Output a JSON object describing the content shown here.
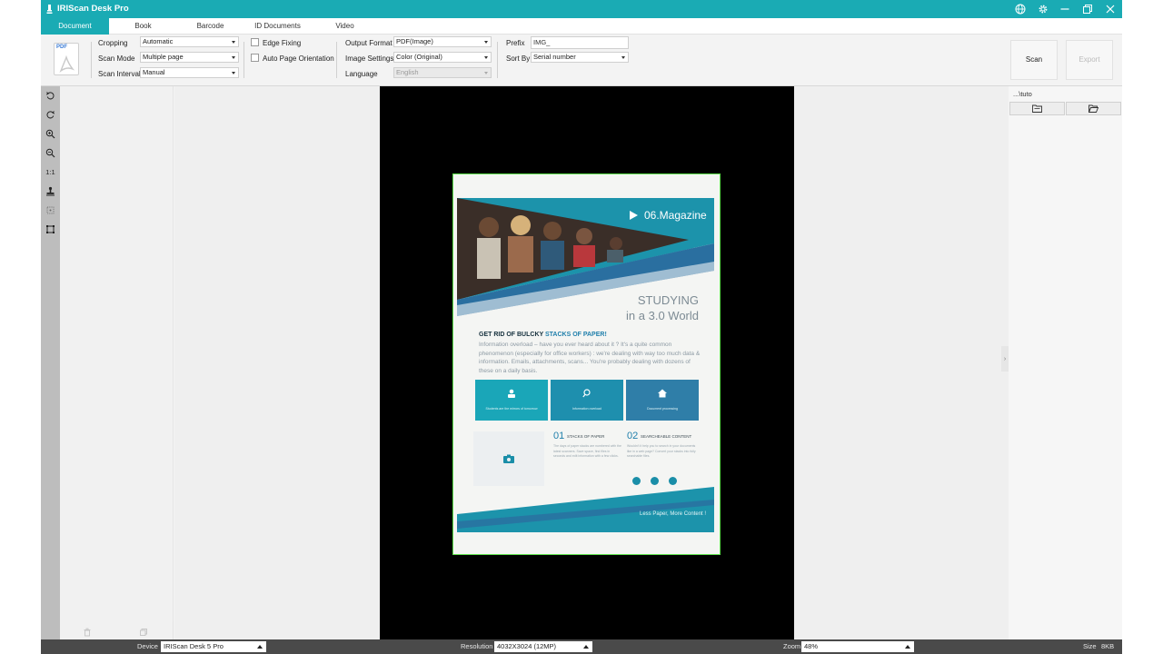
{
  "app": {
    "title": "IRIScan Desk Pro"
  },
  "tabs": [
    {
      "label": "Document",
      "active": true
    },
    {
      "label": "Book",
      "active": false
    },
    {
      "label": "Barcode",
      "active": false
    },
    {
      "label": "ID Documents",
      "active": false
    },
    {
      "label": "Video",
      "active": false
    }
  ],
  "toolbar": {
    "pdf_tag": "PDF",
    "cropping": {
      "label": "Cropping",
      "value": "Automatic"
    },
    "scan_mode": {
      "label": "Scan Mode",
      "value": "Multiple page"
    },
    "scan_interval": {
      "label": "Scan Interval",
      "value": "Manual"
    },
    "edge_fixing": {
      "label": "Edge Fixing",
      "checked": false
    },
    "auto_orientation": {
      "label": "Auto Page Orientation",
      "checked": false
    },
    "output_format": {
      "label": "Output Format",
      "value": "PDF(Image)"
    },
    "image_settings": {
      "label": "Image Settings",
      "value": "Color (Original)"
    },
    "language": {
      "label": "Language",
      "value": "English"
    },
    "prefix": {
      "label": "Prefix",
      "value": "IMG_"
    },
    "sort_by": {
      "label": "Sort By",
      "value": "Serial number"
    },
    "scan_button": "Scan",
    "export_button": "Export"
  },
  "tools": {
    "one_to_one": "1:1"
  },
  "document_preview": {
    "magazine": "06.Magazine",
    "heading_line1": "STUDYING",
    "heading_line2": "in a 3.0 World",
    "subheading_a": "GET RID OF BULCKY ",
    "subheading_b": "STACKS OF PAPER!",
    "body": "Information overload – have you ever heard about it ? It's a quite common phenomenon (especially for office workers) : we're dealing with way too much data & information. Emails, attachments, scans... You're probably dealing with dozens of these on a daily basis.",
    "box1": "Students are the mirrors of tomorrow",
    "box2": "Information overload",
    "box3": "Document processing",
    "num1": "01",
    "num1_label": "STACKS OF PAPER",
    "num2": "02",
    "num2_label": "SEARCHEABLE CONTENT",
    "small1": "The days of paper stacks are numbered with the latest scanners. Save space, find files in seconds and edit information with a few clicks.",
    "small2": "Wouldn't it help you to search in your documents like in a web page? Convert your stacks into fully searchable files.",
    "footer": "Less Paper, More Content !"
  },
  "right_pane": {
    "path": "...\\tuto"
  },
  "status": {
    "device_label": "Device",
    "device_value": "IRIScan Desk 5 Pro",
    "resolution_label": "Resolution",
    "resolution_value": "4032X3024 (12MP)",
    "zoom_label": "Zoom",
    "zoom_value": "48%",
    "size_label": "Size",
    "size_value": "8KB"
  },
  "colors": {
    "accent": "#1aabb4",
    "crop_outline": "#5ee24c",
    "status_bar": "#4a4a4a"
  }
}
